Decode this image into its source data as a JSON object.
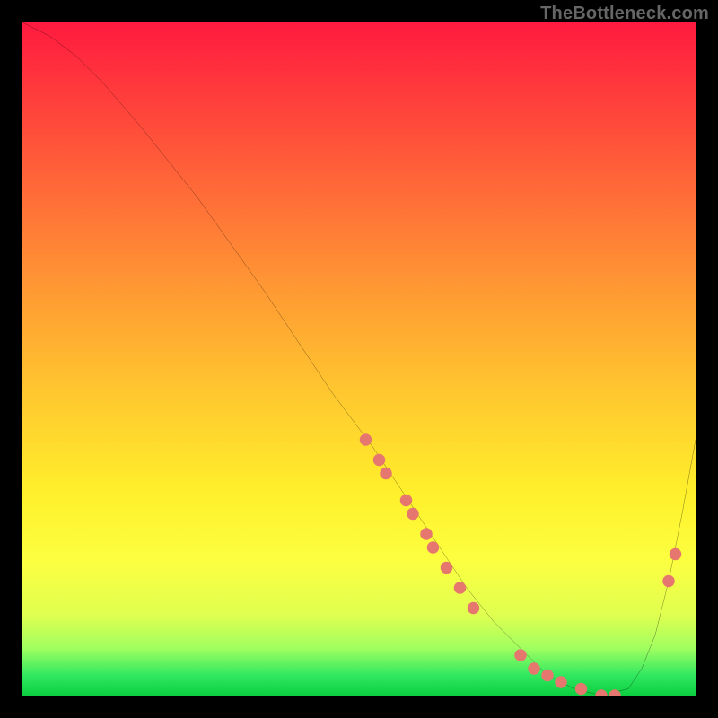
{
  "watermark": "TheBottleneck.com",
  "chart_data": {
    "type": "line",
    "title": "",
    "xlabel": "",
    "ylabel": "",
    "xlim": [
      0,
      100
    ],
    "ylim": [
      0,
      100
    ],
    "series": [
      {
        "name": "curve",
        "x": [
          0,
          4,
          8,
          12,
          18,
          26,
          36,
          46,
          52,
          54,
          58,
          62,
          66,
          70,
          74,
          78,
          82,
          86,
          90,
          92,
          94,
          96,
          98,
          100
        ],
        "y": [
          100,
          98,
          95,
          91,
          84,
          74,
          60,
          45,
          37,
          34,
          28,
          22,
          16,
          11,
          7,
          3,
          1,
          0,
          1,
          4,
          9,
          17,
          27,
          38
        ]
      }
    ],
    "markers": [
      {
        "x": 51,
        "y": 38
      },
      {
        "x": 53,
        "y": 35
      },
      {
        "x": 54,
        "y": 33
      },
      {
        "x": 57,
        "y": 29
      },
      {
        "x": 58,
        "y": 27
      },
      {
        "x": 60,
        "y": 24
      },
      {
        "x": 61,
        "y": 22
      },
      {
        "x": 63,
        "y": 19
      },
      {
        "x": 65,
        "y": 16
      },
      {
        "x": 67,
        "y": 13
      },
      {
        "x": 74,
        "y": 6
      },
      {
        "x": 76,
        "y": 4
      },
      {
        "x": 78,
        "y": 3
      },
      {
        "x": 80,
        "y": 2
      },
      {
        "x": 83,
        "y": 1
      },
      {
        "x": 86,
        "y": 0
      },
      {
        "x": 88,
        "y": 0
      },
      {
        "x": 96,
        "y": 17
      },
      {
        "x": 97,
        "y": 21
      }
    ],
    "gradient_colors": {
      "top": "#ff1a3f",
      "mid_upper": "#ff9a33",
      "mid": "#fff02b",
      "mid_lower": "#e0ff50",
      "bottom": "#0cce3f"
    }
  }
}
